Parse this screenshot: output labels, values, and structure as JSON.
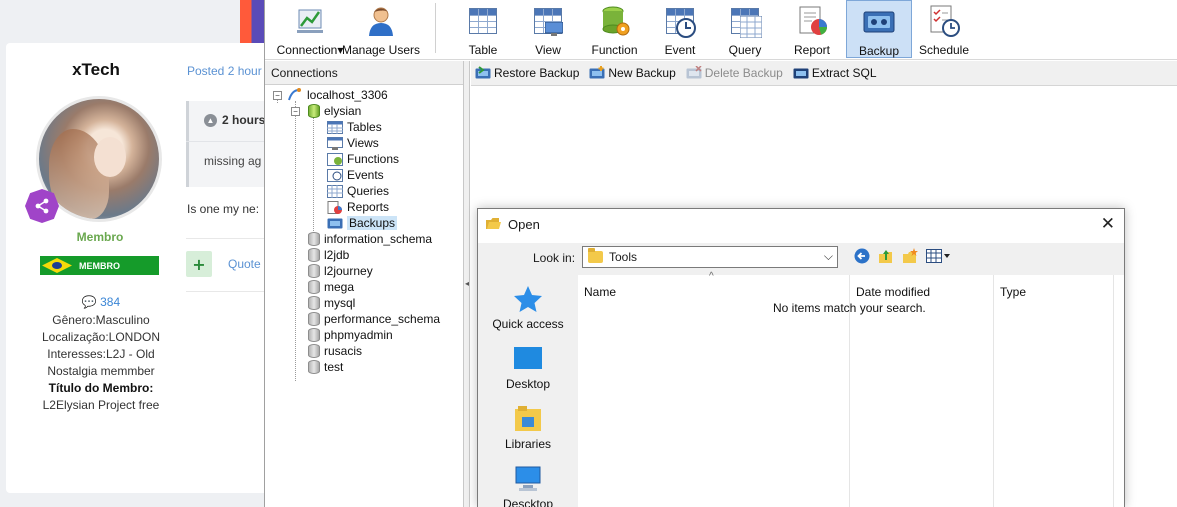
{
  "forum": {
    "username": "xTech",
    "posted": "Posted 2 hour",
    "rank_label": "Membro",
    "rank_bar": "MEMBRO",
    "posts_count": "384",
    "info": [
      "Gênero:Masculino",
      "Localização:LONDON",
      "Interesses:L2J - Old",
      "Nostalgia memmber"
    ],
    "member_title_label": "Título do Membro:",
    "member_title": "L2Elysian Project free",
    "quote_head": "2 hours",
    "quote_body": "missing ag",
    "post_text": "Is one my ne:",
    "plus": "+",
    "quote_link": "Quote"
  },
  "toolbar": {
    "buttons": [
      "Connection",
      "Manage Users",
      "Table",
      "View",
      "Function",
      "Event",
      "Query",
      "Report",
      "Backup",
      "Schedule"
    ],
    "active": "Backup"
  },
  "connections": {
    "header": "Connections",
    "server": "localhost_3306",
    "selected_db": "elysian",
    "children": [
      "Tables",
      "Views",
      "Functions",
      "Events",
      "Queries",
      "Reports",
      "Backups"
    ],
    "selected_child": "Backups",
    "databases": [
      "information_schema",
      "l2jdb",
      "l2journey",
      "mega",
      "mysql",
      "performance_schema",
      "phpmyadmin",
      "rusacis",
      "test"
    ]
  },
  "actions": {
    "restore": "Restore Backup",
    "new": "New Backup",
    "delete": "Delete Backup",
    "extract": "Extract SQL"
  },
  "dialog": {
    "title": "Open",
    "close": "✕",
    "look_in_label": "Look in:",
    "look_in_value": "Tools",
    "places": [
      "Quick access",
      "Desktop",
      "Libraries",
      "Descktop"
    ],
    "columns": [
      "Name",
      "Date modified",
      "Type"
    ],
    "empty_message": "No items match your search."
  },
  "colors": {
    "accent": "#cce0f6",
    "rank_green": "#159b2a",
    "link_blue": "#5b92d3",
    "badge_purple": "#a044c8"
  }
}
